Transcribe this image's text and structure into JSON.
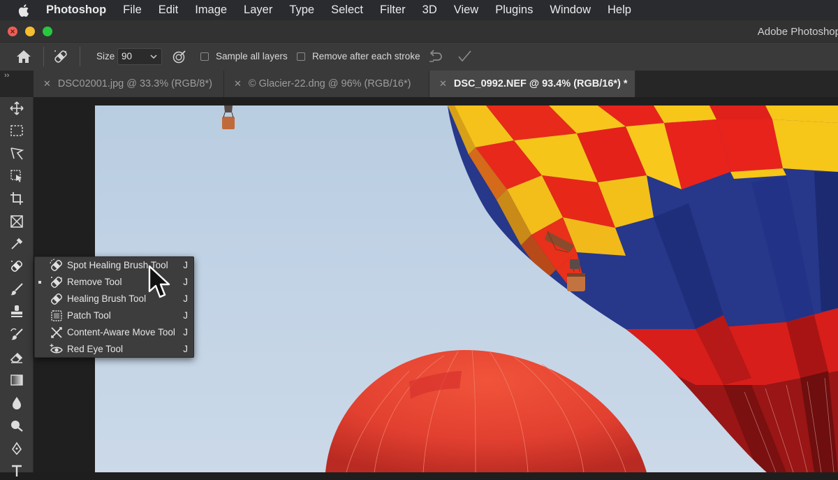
{
  "menubar": {
    "app": "Photoshop",
    "items": [
      "File",
      "Edit",
      "Image",
      "Layer",
      "Type",
      "Select",
      "Filter",
      "3D",
      "View",
      "Plugins",
      "Window",
      "Help"
    ]
  },
  "window": {
    "title": "Adobe Photoshop"
  },
  "options": {
    "size_label": "Size",
    "size_value": "90",
    "sample_all_layers": "Sample all layers",
    "remove_after_stroke": "Remove after each stroke"
  },
  "tabs": [
    {
      "label": "DSC02001.jpg @ 33.3% (RGB/8*)",
      "active": false
    },
    {
      "label": "© Glacier-22.dng @ 96% (RGB/16*)",
      "active": false
    },
    {
      "label": "DSC_0992.NEF @ 93.4% (RGB/16*) *",
      "active": true
    }
  ],
  "toolbar": {
    "tools": [
      "move-tool",
      "rectangular-marquee-tool",
      "lasso-tool",
      "object-selection-tool",
      "crop-tool",
      "frame-tool",
      "eyedropper-tool",
      "healing-tool",
      "brush-tool",
      "clone-stamp-tool",
      "history-brush-tool",
      "eraser-tool",
      "gradient-tool",
      "blur-tool",
      "dodge-tool",
      "pen-tool",
      "type-tool"
    ]
  },
  "flyout": {
    "items": [
      {
        "label": "Spot Healing Brush Tool",
        "key": "J",
        "selected": false,
        "icon": "spot-healing-brush-icon"
      },
      {
        "label": "Remove Tool",
        "key": "J",
        "selected": true,
        "icon": "remove-tool-icon"
      },
      {
        "label": "Healing Brush Tool",
        "key": "J",
        "selected": false,
        "icon": "healing-brush-icon"
      },
      {
        "label": "Patch Tool",
        "key": "J",
        "selected": false,
        "icon": "patch-tool-icon"
      },
      {
        "label": "Content-Aware Move Tool",
        "key": "J",
        "selected": false,
        "icon": "content-aware-move-icon"
      },
      {
        "label": "Red Eye Tool",
        "key": "J",
        "selected": false,
        "icon": "red-eye-icon"
      }
    ]
  },
  "colors": {
    "sky": "#c3d4e6",
    "balloon_red": "#e8231c",
    "balloon_yellow": "#f6c619",
    "balloon_blue": "#283a8c",
    "orange_balloon": "#ea4a33"
  }
}
